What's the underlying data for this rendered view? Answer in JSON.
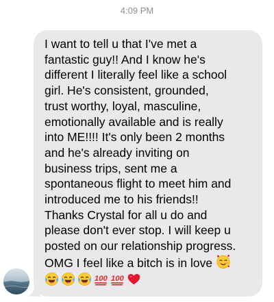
{
  "header": {
    "timestamp": "4:09 PM"
  },
  "contact": {
    "avatar_icon": "contact-avatar-photo"
  },
  "message": {
    "lines": [
      "I want to tell u that I've met a",
      "fantastic guy!! And I know he's",
      "different I literally feel like a school",
      "girl. He's consistent, grounded,",
      "trust worthy, loyal, masculine,",
      "emotionally available and is really",
      "into ME!!!! It's only been 2 months",
      "and he's already inviting on",
      "business trips, sent me a",
      "spontaneous flight to meet him and",
      "introduced me to his friends!!",
      "Thanks Crystal for all u do and",
      "please don't ever stop. I will keep u",
      "posted on our relationship progress.",
      "OMG I feel like a bitch is in love"
    ],
    "inline_emoji": "smiling-face-with-hearts-emoji",
    "emoji_row": [
      "face-with-tears-of-joy-emoji",
      "face-with-tears-of-joy-emoji",
      "face-with-tears-of-joy-emoji",
      "hundred-points-emoji",
      "hundred-points-emoji",
      "red-heart-emoji"
    ]
  },
  "colors": {
    "bubble": "#e9e9eb",
    "text": "#000000",
    "timestamp": "#8e8e93",
    "background": "#ffffff"
  }
}
